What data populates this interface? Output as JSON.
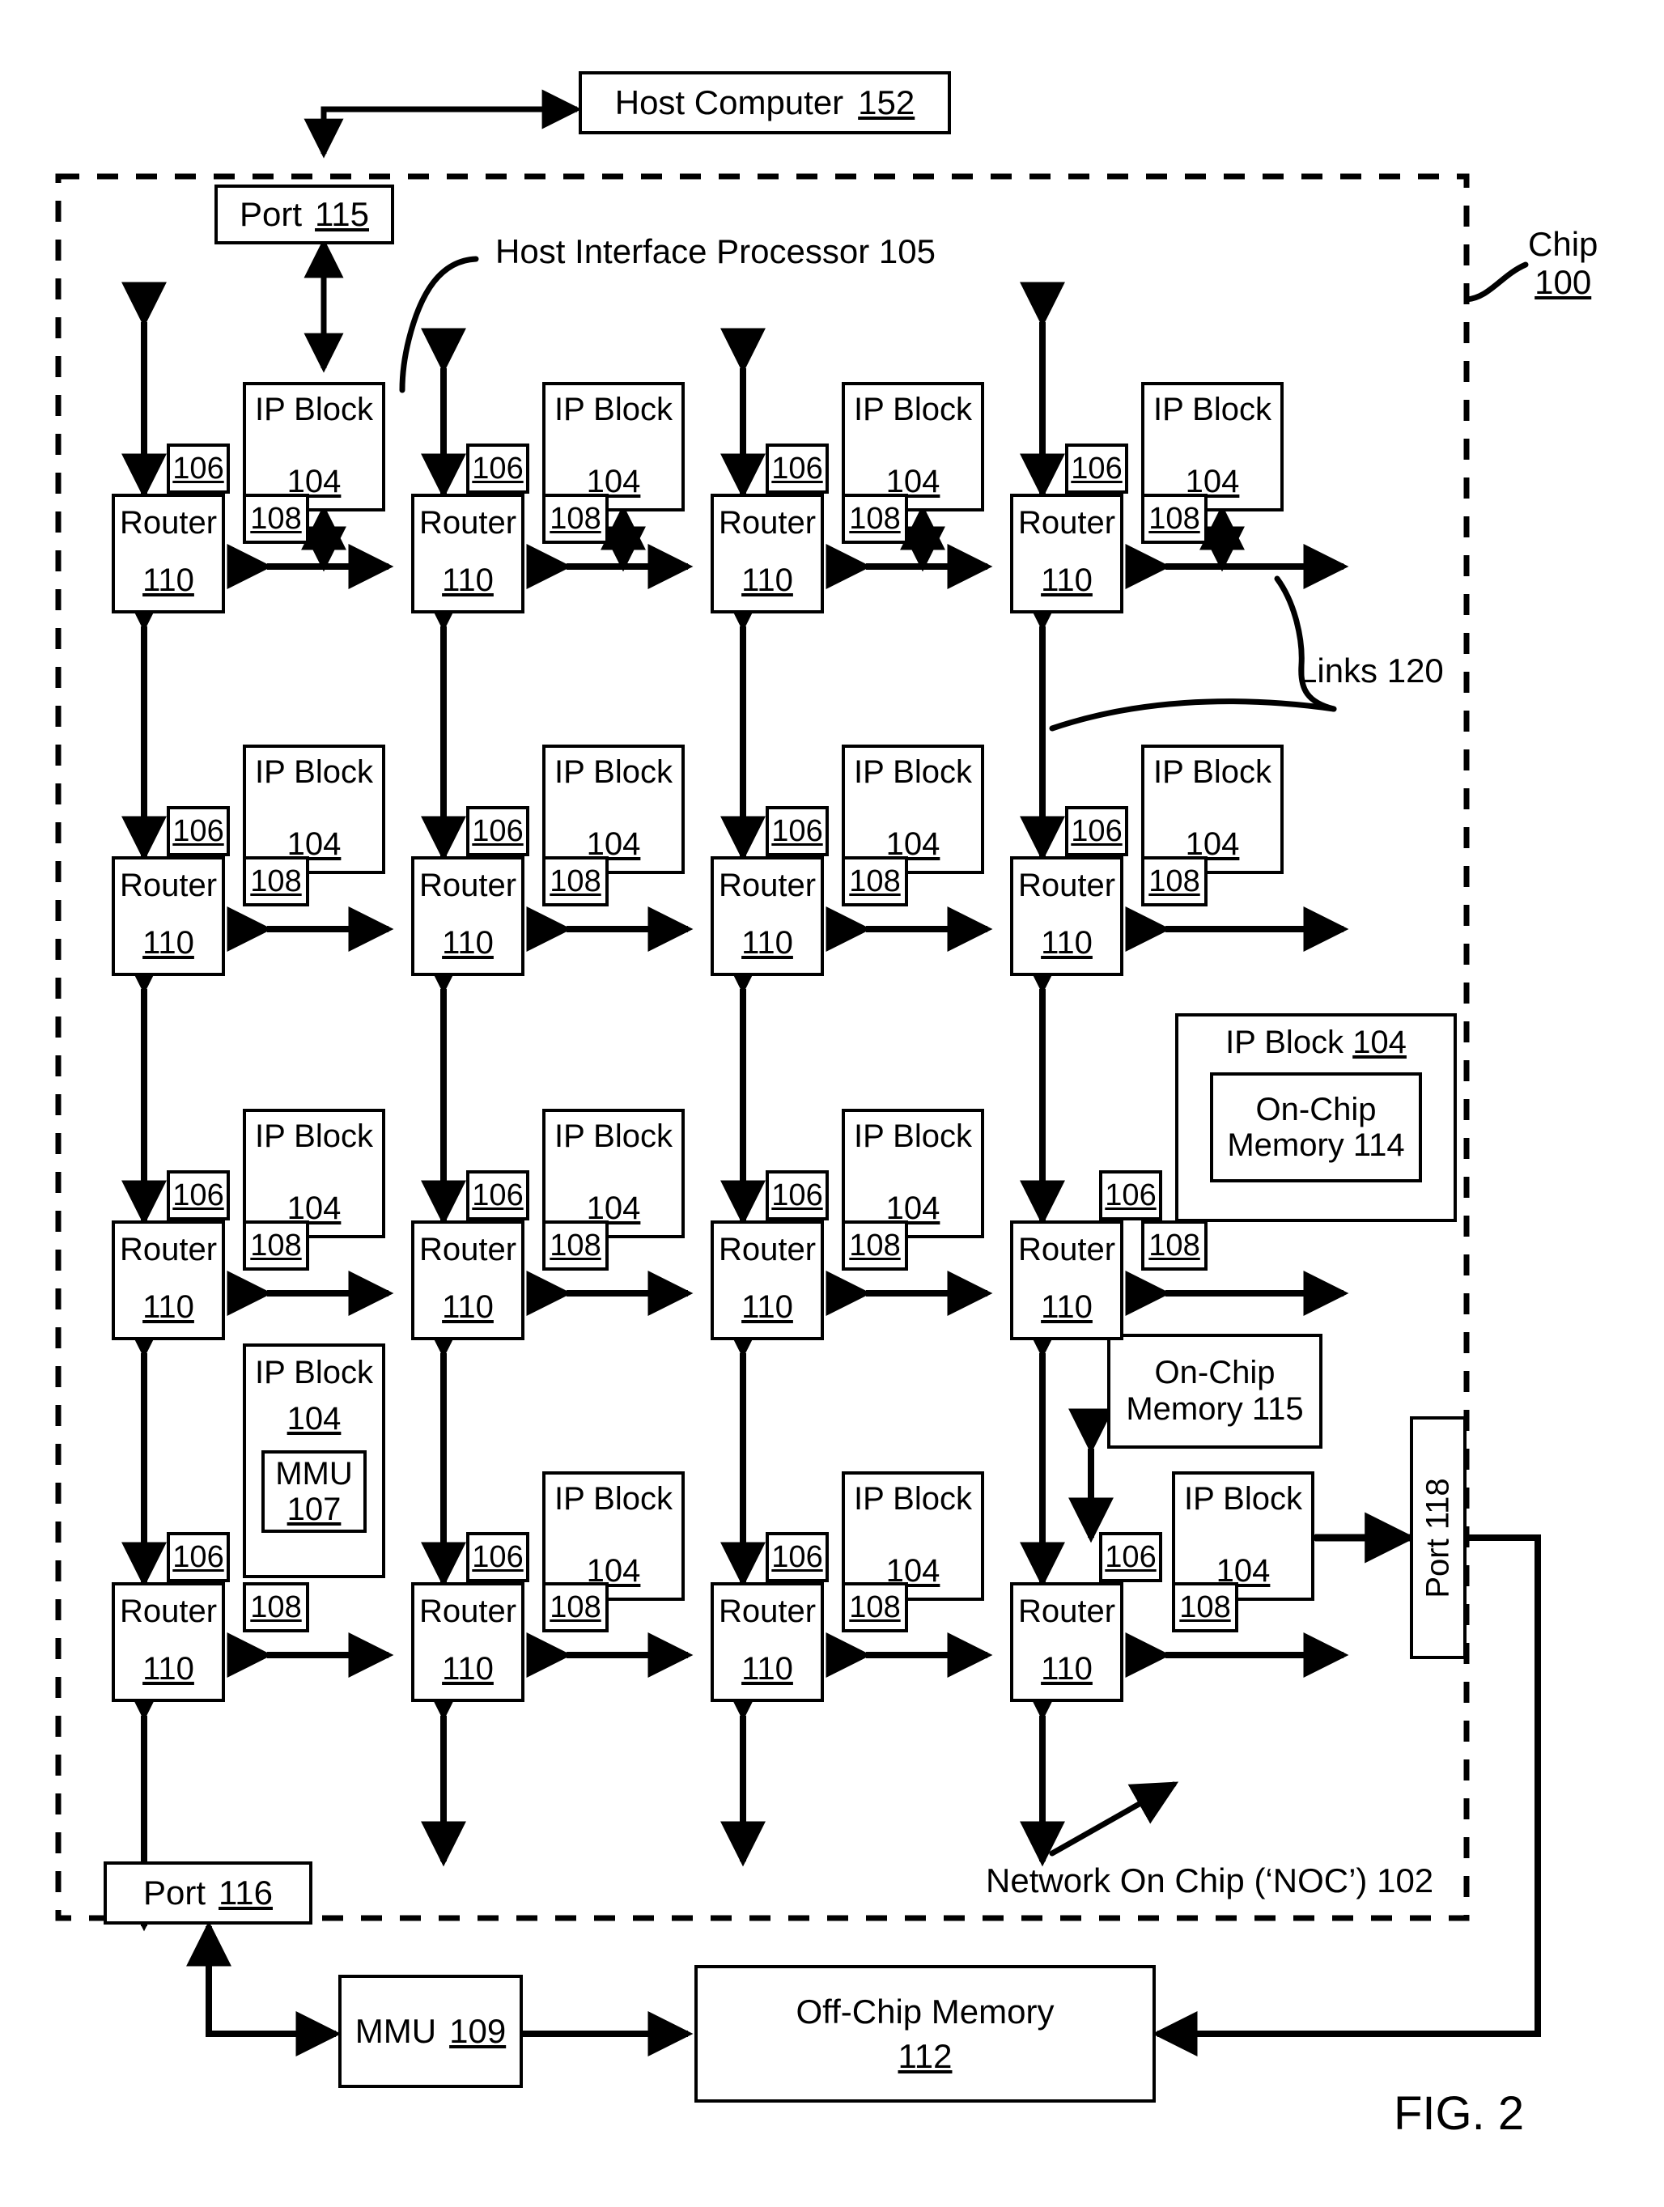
{
  "figure": {
    "label": "FIG. 2",
    "chip_label_line1": "Chip",
    "chip_label_line2": "100",
    "noc_label": "Network On Chip (‘NOC’) 102",
    "links_label": "Links 120",
    "host_interface_label": "Host Interface Processor 105"
  },
  "host": {
    "computer_label": "Host Computer",
    "computer_ref": "152"
  },
  "ports": {
    "top": {
      "label": "Port",
      "ref": "115"
    },
    "bottom_left": {
      "label": "Port",
      "ref": "116"
    },
    "right": {
      "label": "Port  118"
    }
  },
  "external": {
    "mmu": {
      "label": "MMU",
      "ref": "109"
    },
    "off_chip_memory": {
      "line1": "Off-Chip Memory",
      "ref": "112"
    }
  },
  "cell": {
    "router_label": "Router",
    "router_ref": "110",
    "ip_block_label": "IP Block",
    "ip_block_ref": "104",
    "tab_106": "106",
    "tab_108": "108"
  },
  "special_blocks": {
    "on_chip_memory_114": {
      "line1": "On-Chip",
      "line2": "Memory 114"
    },
    "on_chip_memory_115": {
      "line1": "On-Chip",
      "line2": "Memory 115"
    },
    "mmu_107": {
      "label": "MMU",
      "ref": "107"
    },
    "ip_block_114_header": "IP Block 104"
  },
  "grid": {
    "rows": 4,
    "cols": 4,
    "cells": [
      [
        {
          "ip_variant": "standard"
        },
        {
          "ip_variant": "standard"
        },
        {
          "ip_variant": "standard"
        },
        {
          "ip_variant": "standard"
        }
      ],
      [
        {
          "ip_variant": "standard"
        },
        {
          "ip_variant": "standard"
        },
        {
          "ip_variant": "standard"
        },
        {
          "ip_variant": "standard"
        }
      ],
      [
        {
          "ip_variant": "standard"
        },
        {
          "ip_variant": "standard"
        },
        {
          "ip_variant": "standard"
        },
        {
          "ip_variant": "memory114"
        }
      ],
      [
        {
          "ip_variant": "mmu107"
        },
        {
          "ip_variant": "standard"
        },
        {
          "ip_variant": "standard"
        },
        {
          "ip_variant": "memory115"
        }
      ]
    ]
  }
}
